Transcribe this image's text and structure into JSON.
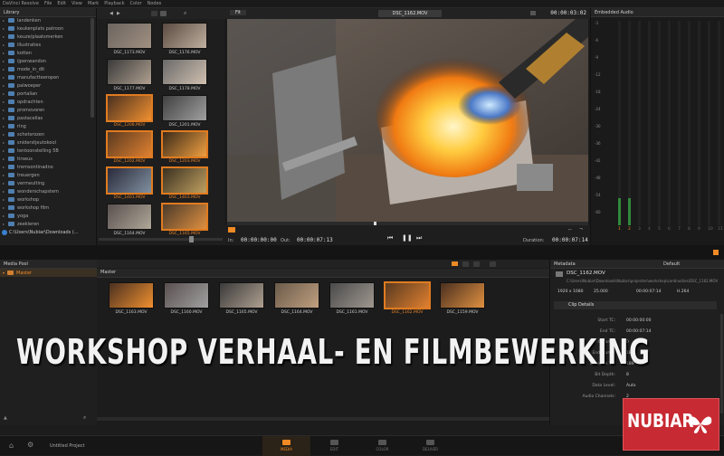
{
  "app": {
    "menu": [
      "DaVinci Resolve",
      "File",
      "Edit",
      "View",
      "Mark",
      "Playback",
      "Color",
      "Nodes"
    ]
  },
  "library": {
    "title": "Library",
    "items": [
      "landenken",
      "keukenplats patroon",
      "keuze/plaatsmerken",
      "illustraties",
      "kotten",
      "ijpenwandon",
      "mode_in_dit",
      "manufactteeropen",
      "palwoeper",
      "portalian",
      "opdrachten",
      "promovoren",
      "pastacellas",
      "ring",
      "schetsrozen",
      "sniderstjeutokool",
      "tentoonstelling 5B",
      "tirseus",
      "tremsontinadno",
      "treuergen",
      "vermeulting",
      "wonderschapstem",
      "workshop",
      "workshop film",
      "yoga",
      "zeekleren"
    ],
    "drive_path": "C:\\Users\\Nubiar\\Downloads (..."
  },
  "browser": {
    "clips": [
      {
        "name": "DSC_1173.MOV",
        "selected": false
      },
      {
        "name": "DSC_1176.MOV",
        "selected": false
      },
      {
        "name": "DSC_1177.MOV",
        "selected": false
      },
      {
        "name": "DSC_1178.MOV",
        "selected": false
      },
      {
        "name": "DSC_1208.MOV",
        "selected": true
      },
      {
        "name": "DSC_1201.MOV",
        "selected": false
      },
      {
        "name": "DSC_1202.MOV",
        "selected": true
      },
      {
        "name": "DSC_1203.MOV",
        "selected": true
      },
      {
        "name": "DSC_1401.MOV",
        "selected": true
      },
      {
        "name": "DSC_1403.MOV",
        "selected": true
      },
      {
        "name": "DSC_1164.MOV",
        "selected": false
      },
      {
        "name": "DSC_1165.MOV",
        "selected": true
      }
    ]
  },
  "viewer": {
    "fit": "Fit",
    "clip_name": "DSC_1162.MOV",
    "timecode": "00:00:03:02",
    "in_label": "In:",
    "in_tc": "00:00:00:00",
    "out_label": "Out:",
    "out_tc": "00:00:07:13",
    "duration_label": "Duration:",
    "duration_tc": "00:00:07:14"
  },
  "audio": {
    "title": "Embedded Audio",
    "channels": [
      "1",
      "2",
      "3",
      "4",
      "5",
      "6",
      "7",
      "8",
      "9",
      "10",
      "11"
    ],
    "scale": [
      "-3",
      "-6",
      "-9",
      "-12",
      "-18",
      "-24",
      "-30",
      "-36",
      "-42",
      "-48",
      "-54",
      "-60"
    ]
  },
  "media_pool": {
    "title": "Media Pool",
    "root": "Master",
    "bin_header": "Master",
    "clips": [
      {
        "name": "DSC_1163.MOV",
        "selected": false
      },
      {
        "name": "DSC_1160.MOV",
        "selected": false
      },
      {
        "name": "DSC_1165.MOV",
        "selected": false
      },
      {
        "name": "DSC_1164.MOV",
        "selected": false
      },
      {
        "name": "DSC_1161.MOV",
        "selected": false
      },
      {
        "name": "DSC_1162.MOV",
        "selected": true
      },
      {
        "name": "DSC_1159.MOV",
        "selected": false
      }
    ]
  },
  "metadata": {
    "title": "Metadata",
    "preset": "Default",
    "clip_name": "DSC_1162.MOV",
    "clip_path": "C:\\Users\\Nubiar\\Downloads\\Nubiar\\projecten\\workshop\\continuities\\DSC_1162.MOV",
    "resolution": "1920 x 1080",
    "fps": "25.000",
    "duration": "00:00:07:14",
    "codec": "H.264",
    "section": "Clip Details",
    "rows": [
      {
        "k": "Start TC:",
        "v": "00:00:00:00"
      },
      {
        "k": "End TC:",
        "v": "00:00:07:14"
      },
      {
        "k": "Start Frame:",
        "v": "0"
      },
      {
        "k": "End Frame:",
        "v": "185"
      },
      {
        "k": "Duration TC:",
        "v": "189"
      },
      {
        "k": "Bit Depth:",
        "v": "8"
      },
      {
        "k": "Data Level:",
        "v": "Auto"
      },
      {
        "k": "Audio Channels:",
        "v": "2"
      }
    ]
  },
  "footer": {
    "project": "Untitled Project",
    "pages": [
      {
        "label": "MEDIA",
        "active": true
      },
      {
        "label": "EDIT",
        "active": false
      },
      {
        "label": "COLOR",
        "active": false
      },
      {
        "label": "DELIVER",
        "active": false
      }
    ]
  },
  "overlay": {
    "title": "WORKSHOP VERHAAL- EN FILMBEWERKING",
    "logo": "NUBIAR"
  },
  "colors": {
    "accent": "#f08a24",
    "logo_bg": "#c72a32"
  }
}
